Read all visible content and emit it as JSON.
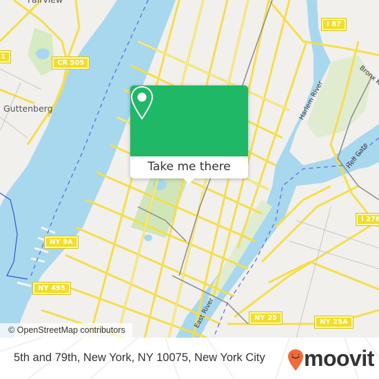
{
  "map": {
    "place_labels": {
      "fairview": "Fairview",
      "guttenberg": "Guttenberg"
    },
    "water_labels": {
      "harlem_river": "Harlem River",
      "bronx_kill": "Bronx Kill",
      "hell_gate": "Hell Gate",
      "east_river": "East River"
    },
    "route_shields": {
      "cr505": "CR 505",
      "i87": "I 87",
      "i278": "I 278",
      "ny9a": "NY 9A",
      "ny495": "NY 495",
      "ny25": "NY 25",
      "ny25a": "NY 25A",
      "left_edge": "1"
    },
    "colors": {
      "water": "#a8d8ee",
      "land": "#f2f0ec",
      "road": "#f5de4a",
      "park": "#d6ebc0"
    },
    "attribution": "© OpenStreetMap contributors"
  },
  "popup": {
    "icon": "location-pin-icon",
    "button_label": "Take me there",
    "color": "#1fb866"
  },
  "footer": {
    "address": "5th and 79th, New York, NY 10075, New York City",
    "logo_text": "moovit",
    "logo_color": "#f26b3a"
  }
}
